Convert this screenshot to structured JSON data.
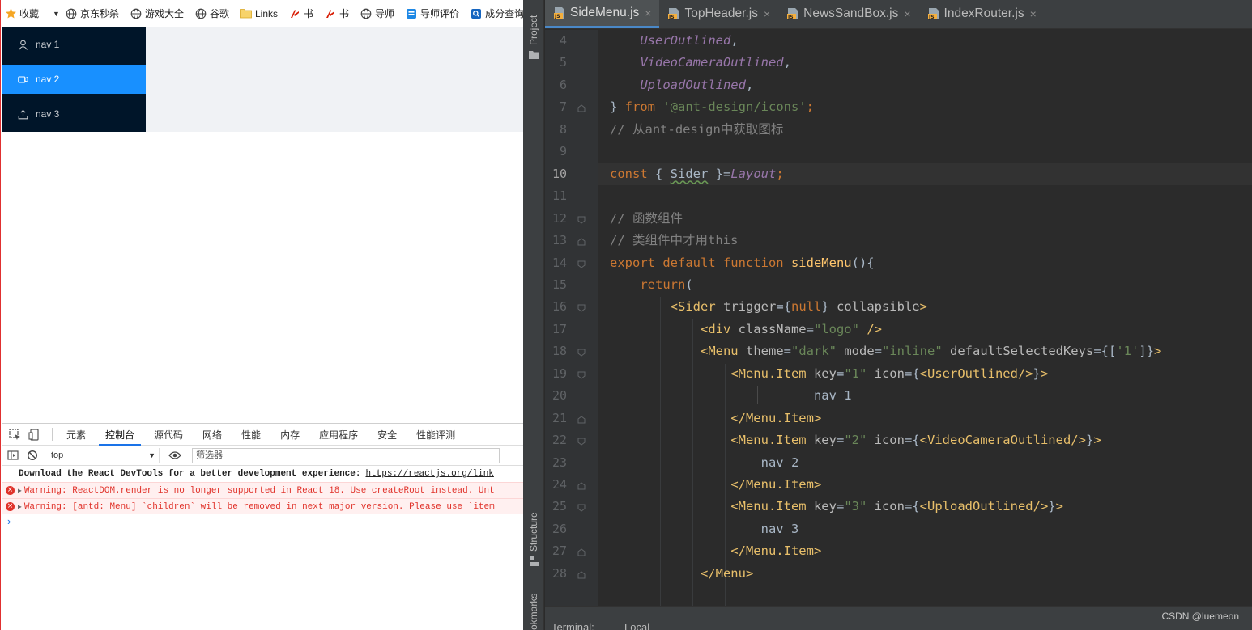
{
  "bookmarks_bar": {
    "items": [
      {
        "label": "收藏",
        "icon": "star-icon"
      },
      {
        "label": "京东秒杀",
        "icon": "globe-icon"
      },
      {
        "label": "游戏大全",
        "icon": "globe-icon"
      },
      {
        "label": "谷歌",
        "icon": "globe-icon"
      },
      {
        "label": "Links",
        "icon": "folder-icon"
      },
      {
        "label": "书",
        "icon": "book-red-icon"
      },
      {
        "label": "书",
        "icon": "book-red-icon"
      },
      {
        "label": "导师",
        "icon": "globe-icon"
      },
      {
        "label": "导师评价",
        "icon": "blue-app-icon"
      },
      {
        "label": "成分查询",
        "icon": "search-app-icon"
      }
    ]
  },
  "app_menu": {
    "items": [
      {
        "label": "nav 1",
        "icon": "user-icon",
        "selected": false
      },
      {
        "label": "nav 2",
        "icon": "video-camera-icon",
        "selected": true
      },
      {
        "label": "nav 3",
        "icon": "upload-icon",
        "selected": false
      }
    ]
  },
  "devtools": {
    "tabs": [
      "元素",
      "控制台",
      "源代码",
      "网络",
      "性能",
      "内存",
      "应用程序",
      "安全",
      "性能评测"
    ],
    "active_tab": "控制台",
    "context": "top",
    "filter_placeholder": "筛选器",
    "console": {
      "info_text": "Download the React DevTools for a better development experience:",
      "info_link": "https://reactjs.org/link",
      "errors": [
        "Warning: ReactDOM.render is no longer supported in React 18. Use createRoot instead. Unt",
        "Warning: [antd: Menu] `children` will be removed in next major version. Please use `item"
      ],
      "prompt": "›"
    }
  },
  "ide": {
    "side_labels": {
      "project": "Project",
      "structure": "Structure",
      "bookmarks": "okmarks"
    },
    "tabs": [
      {
        "label": "SideMenu.js",
        "active": true
      },
      {
        "label": "TopHeader.js",
        "active": false
      },
      {
        "label": "NewsSandBox.js",
        "active": false
      },
      {
        "label": "IndexRouter.js",
        "active": false
      }
    ],
    "current_line": "10",
    "bottom_tools": [
      "Terminal:",
      "Local"
    ],
    "code_lines": [
      {
        "n": "4",
        "segs": [
          [
            "pur",
            "UserOutlined"
          ],
          [
            "txt",
            ","
          ]
        ]
      },
      {
        "n": "5",
        "segs": [
          [
            "pur",
            "VideoCameraOutlined"
          ],
          [
            "txt",
            ","
          ]
        ]
      },
      {
        "n": "6",
        "segs": [
          [
            "pur",
            "UploadOutlined"
          ],
          [
            "txt",
            ","
          ]
        ]
      },
      {
        "n": "7",
        "segs": [
          [
            "txt",
            "} "
          ],
          [
            "kw",
            "from"
          ],
          [
            "txt",
            " "
          ],
          [
            "str",
            "'@ant-design/icons'"
          ],
          [
            "kw",
            ";"
          ]
        ]
      },
      {
        "n": "8",
        "segs": [
          [
            "cmt",
            "// 从ant-design中获取图标"
          ]
        ]
      },
      {
        "n": "9",
        "segs": []
      },
      {
        "n": "10",
        "segs": [
          [
            "kw",
            "const"
          ],
          [
            "txt",
            " { "
          ],
          [
            "squig",
            "Sider"
          ],
          [
            "txt",
            " }="
          ],
          [
            "pur",
            "Layout"
          ],
          [
            "kw",
            ";"
          ]
        ]
      },
      {
        "n": "11",
        "segs": []
      },
      {
        "n": "12",
        "segs": [
          [
            "cmt",
            "// 函数组件"
          ]
        ]
      },
      {
        "n": "13",
        "segs": [
          [
            "cmt",
            "// 类组件中才用this"
          ]
        ]
      },
      {
        "n": "14",
        "segs": [
          [
            "kw",
            "export default function "
          ],
          [
            "fn",
            "sideMenu"
          ],
          [
            "txt",
            "(){"
          ]
        ]
      },
      {
        "n": "15",
        "segs": [
          [
            "txt",
            "    "
          ],
          [
            "kw",
            "return"
          ],
          [
            "txt",
            "("
          ]
        ]
      },
      {
        "n": "16",
        "segs": [
          [
            "txt",
            "        "
          ],
          [
            "tag",
            "<Sider"
          ],
          [
            "attr",
            " trigger"
          ],
          [
            "txt",
            "={"
          ],
          [
            "kw",
            "null"
          ],
          [
            "txt",
            "}"
          ],
          [
            "attr",
            " collapsible"
          ],
          [
            "tag",
            ">"
          ]
        ]
      },
      {
        "n": "17",
        "segs": [
          [
            "txt",
            "            "
          ],
          [
            "tag",
            "<div"
          ],
          [
            "attr",
            " className"
          ],
          [
            "txt",
            "="
          ],
          [
            "str",
            "\"logo\""
          ],
          [
            "tag",
            " />"
          ]
        ]
      },
      {
        "n": "18",
        "segs": [
          [
            "txt",
            "            "
          ],
          [
            "tag",
            "<Menu"
          ],
          [
            "attr",
            " theme"
          ],
          [
            "txt",
            "="
          ],
          [
            "str",
            "\"dark\""
          ],
          [
            "attr",
            " mode"
          ],
          [
            "txt",
            "="
          ],
          [
            "str",
            "\"inline\""
          ],
          [
            "attr",
            " defaultSelectedKeys"
          ],
          [
            "txt",
            "={["
          ],
          [
            "str",
            "'1'"
          ],
          [
            "txt",
            "]}"
          ],
          [
            "tag",
            ">"
          ]
        ]
      },
      {
        "n": "19",
        "segs": [
          [
            "txt",
            "                "
          ],
          [
            "tag",
            "<Menu.Item"
          ],
          [
            "attr",
            " key"
          ],
          [
            "txt",
            "="
          ],
          [
            "str",
            "\"1\""
          ],
          [
            "attr",
            " icon"
          ],
          [
            "txt",
            "={"
          ],
          [
            "tag",
            "<UserOutlined/>"
          ],
          [
            "txt",
            "}"
          ],
          [
            "tag",
            ">"
          ]
        ]
      },
      {
        "n": "20",
        "segs": [
          [
            "txt",
            "                           nav 1"
          ]
        ]
      },
      {
        "n": "21",
        "segs": [
          [
            "txt",
            "                "
          ],
          [
            "tag",
            "</Menu.Item>"
          ]
        ]
      },
      {
        "n": "22",
        "segs": [
          [
            "txt",
            "                "
          ],
          [
            "tag",
            "<Menu.Item"
          ],
          [
            "attr",
            " key"
          ],
          [
            "txt",
            "="
          ],
          [
            "str",
            "\"2\""
          ],
          [
            "attr",
            " icon"
          ],
          [
            "txt",
            "={"
          ],
          [
            "tag",
            "<VideoCameraOutlined/>"
          ],
          [
            "txt",
            "}"
          ],
          [
            "tag",
            ">"
          ]
        ]
      },
      {
        "n": "23",
        "segs": [
          [
            "txt",
            "                    nav 2"
          ]
        ]
      },
      {
        "n": "24",
        "segs": [
          [
            "txt",
            "                "
          ],
          [
            "tag",
            "</Menu.Item>"
          ]
        ]
      },
      {
        "n": "25",
        "segs": [
          [
            "txt",
            "                "
          ],
          [
            "tag",
            "<Menu.Item"
          ],
          [
            "attr",
            " key"
          ],
          [
            "txt",
            "="
          ],
          [
            "str",
            "\"3\""
          ],
          [
            "attr",
            " icon"
          ],
          [
            "txt",
            "={"
          ],
          [
            "tag",
            "<UploadOutlined/>"
          ],
          [
            "txt",
            "}"
          ],
          [
            "tag",
            ">"
          ]
        ]
      },
      {
        "n": "26",
        "segs": [
          [
            "txt",
            "                    nav 3"
          ]
        ]
      },
      {
        "n": "27",
        "segs": [
          [
            "txt",
            "                "
          ],
          [
            "tag",
            "</Menu.Item>"
          ]
        ]
      },
      {
        "n": "28",
        "segs": [
          [
            "txt",
            "            "
          ],
          [
            "tag",
            "</Menu>"
          ]
        ]
      }
    ]
  },
  "watermark": "CSDN @luemeon",
  "colors": {
    "sider_bg": "#001529",
    "menu_selected": "#1890ff",
    "content_bg": "#f0f2f5",
    "ide_bg": "#2b2b2b",
    "keyword": "#cc7832",
    "string": "#6a8759",
    "comment": "#808080",
    "constant": "#9876aa",
    "tag": "#e8bf6a",
    "function": "#ffc66d"
  }
}
